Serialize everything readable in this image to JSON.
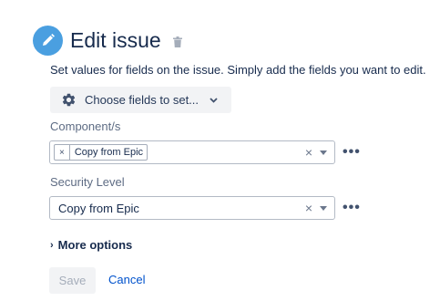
{
  "header": {
    "title": "Edit issue",
    "icon_color": "#4a9fe0"
  },
  "description": "Set values for fields on the issue. Simply add the fields you want to edit.",
  "choose_fields": {
    "label": "Choose fields to set..."
  },
  "fields": [
    {
      "label": "Component/s",
      "tags": [
        "Copy from Epic"
      ],
      "clear": "×"
    },
    {
      "label": "Security Level",
      "value": "Copy from Epic",
      "clear": "×"
    }
  ],
  "more_menu": "•••",
  "tag_remove": "×",
  "more_options": {
    "arrow": "›",
    "label": "More options"
  },
  "actions": {
    "save_label": "Save",
    "cancel_label": "Cancel"
  }
}
